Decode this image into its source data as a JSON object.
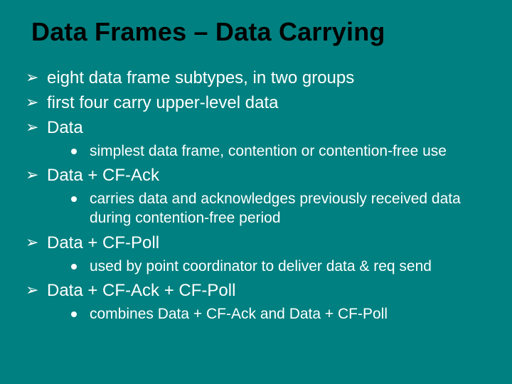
{
  "title": "Data Frames – Data Carrying",
  "bullets": [
    {
      "text": "eight data frame subtypes, in two groups",
      "sub": []
    },
    {
      "text": "first four carry upper-level data",
      "sub": []
    },
    {
      "text": "Data",
      "sub": [
        {
          "text": "simplest data frame, contention or contention-free use"
        }
      ]
    },
    {
      "text": "Data + CF-Ack",
      "sub": [
        {
          "text": "carries data and acknowledges previously received data during contention-free period"
        }
      ]
    },
    {
      "text": "Data + CF-Poll",
      "sub": [
        {
          "text": "used by point coordinator to deliver data & req send"
        }
      ]
    },
    {
      "text": "Data + CF-Ack + CF-Poll",
      "sub": [
        {
          "text": "combines Data + CF-Ack and Data + CF-Poll"
        }
      ]
    }
  ]
}
